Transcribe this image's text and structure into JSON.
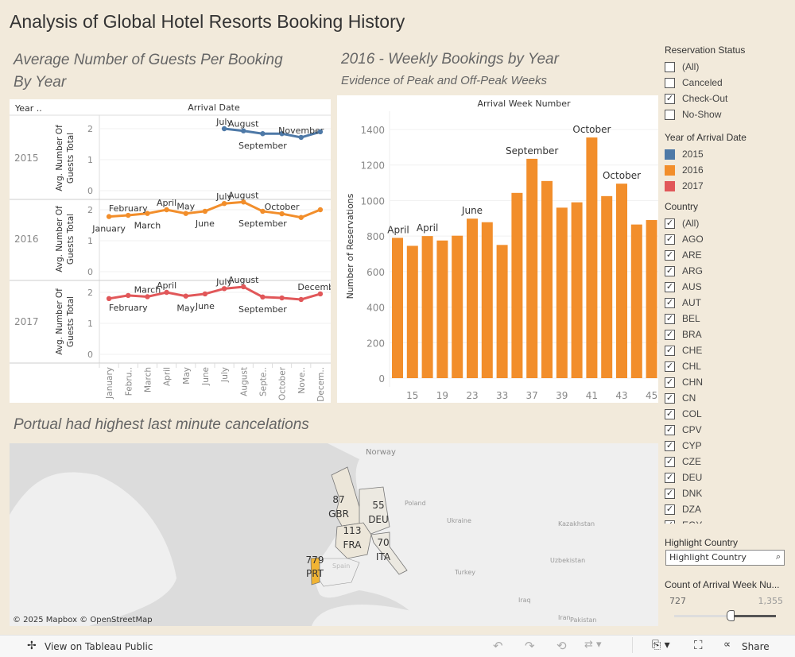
{
  "title": "Analysis of Global Hotel Resorts Booking History",
  "guests_chart": {
    "title_line1": "Average Number of Guests Per Booking",
    "title_line2": "By Year",
    "row_header": "Year ..",
    "col_header": "Arrival Date",
    "y_axis_label_line1": "Avg. Number Of",
    "y_axis_label_line2": "Guests Total",
    "y_ticks": [
      "0",
      "1",
      "2"
    ],
    "months_axis": [
      "January",
      "Febru..",
      "March",
      "April",
      "May",
      "June",
      "July",
      "August",
      "Septe..",
      "October",
      "Nove..",
      "Decem.."
    ]
  },
  "chart_data": [
    {
      "type": "line",
      "title": "Average Number of Guests Per Booking By Year",
      "xlabel": "Arrival Date",
      "ylabel": "Avg. Number Of Guests Total",
      "ylim": [
        0,
        2.3
      ],
      "categories": [
        "January",
        "February",
        "March",
        "April",
        "May",
        "June",
        "July",
        "August",
        "September",
        "October",
        "November",
        "December"
      ],
      "series": [
        {
          "name": "2015",
          "color": "#4e79a7",
          "values": [
            null,
            null,
            null,
            null,
            null,
            null,
            2.0,
            1.93,
            1.84,
            1.84,
            1.72,
            1.9
          ],
          "labels_above": [
            "July",
            "August",
            "November"
          ],
          "labels_below": [
            "September"
          ]
        },
        {
          "name": "2016",
          "color": "#f28e2b",
          "values": [
            1.78,
            1.82,
            1.88,
            2.0,
            1.88,
            1.95,
            2.2,
            2.25,
            1.95,
            1.87,
            1.75,
            2.0
          ],
          "labels_above": [
            "February",
            "April",
            "May",
            "July",
            "August",
            "October"
          ],
          "labels_below": [
            "January",
            "March",
            "June",
            "September"
          ]
        },
        {
          "name": "2017",
          "color": "#e15759",
          "values": [
            1.8,
            1.9,
            1.86,
            2.0,
            1.88,
            1.95,
            2.12,
            2.18,
            1.85,
            1.82,
            1.77,
            1.95
          ],
          "labels_above": [
            "March",
            "April",
            "July",
            "August",
            "December"
          ],
          "labels_below": [
            "February",
            "May",
            "June",
            "September"
          ]
        }
      ]
    },
    {
      "type": "bar",
      "title": "2016 - Weekly Bookings by Year",
      "subtitle": "Evidence of Peak and Off-Peak Weeks",
      "xlabel": "Arrival Week Number",
      "ylabel": "Number of Reservations",
      "ylim": [
        0,
        1450
      ],
      "y_ticks": [
        0,
        200,
        400,
        600,
        800,
        1000,
        1200,
        1400
      ],
      "categories": [
        "",
        "15",
        "",
        "19",
        "",
        "23",
        "",
        "33",
        "",
        "37",
        "",
        "39",
        "",
        "41",
        "",
        "43",
        "",
        "45"
      ],
      "values": [
        790,
        745,
        800,
        775,
        802,
        898,
        878,
        750,
        1043,
        1235,
        1110,
        960,
        990,
        1355,
        1025,
        1095,
        865,
        890
      ],
      "bar_labels": [
        "April",
        "",
        "April",
        "",
        "",
        "June",
        "",
        "",
        "",
        "September",
        "",
        "",
        "",
        "October",
        "",
        "October",
        "",
        ""
      ],
      "color": "#f28e2b"
    }
  ],
  "map": {
    "title": "Portual had highest last minute cancelations",
    "attribution": "© 2025 Mapbox  © OpenStreetMap",
    "countries": [
      {
        "code": "GBR",
        "value": "87"
      },
      {
        "code": "DEU",
        "value": "55"
      },
      {
        "code": "FRA",
        "value": "113"
      },
      {
        "code": "ITA",
        "value": "70"
      },
      {
        "code": "PRT",
        "value": "779"
      }
    ],
    "place_names": [
      "Norway",
      "Poland",
      "Ukraine",
      "Kazakhstan",
      "Turkey",
      "Spain",
      "Iraq",
      "Iran",
      "Pakistan",
      "Uzbekistan"
    ]
  },
  "filters": {
    "reservation_status": {
      "title": "Reservation Status",
      "items": [
        {
          "label": "(All)",
          "checked": false
        },
        {
          "label": "Canceled",
          "checked": false
        },
        {
          "label": "Check-Out",
          "checked": true
        },
        {
          "label": "No-Show",
          "checked": false
        }
      ]
    },
    "year_legend": {
      "title": "Year of Arrival Date",
      "items": [
        {
          "label": "2015",
          "color": "#4e79a7"
        },
        {
          "label": "2016",
          "color": "#f28e2b"
        },
        {
          "label": "2017",
          "color": "#e15759"
        }
      ]
    },
    "country": {
      "title": "Country",
      "items": [
        "(All)",
        "AGO",
        "ARE",
        "ARG",
        "AUS",
        "AUT",
        "BEL",
        "BRA",
        "CHE",
        "CHL",
        "CHN",
        "CN",
        "COL",
        "CPV",
        "CYP",
        "CZE",
        "DEU",
        "DNK",
        "DZA",
        "EGY"
      ]
    },
    "highlight": {
      "title": "Highlight Country",
      "placeholder": "Highlight Country"
    },
    "slider": {
      "title": "Count of Arrival Week Nu...",
      "min_label": "727",
      "max_label": "1,355",
      "min": 727,
      "max": 1355,
      "value": 1100
    }
  },
  "toolbar": {
    "view_label": "View on Tableau Public",
    "share_label": "Share"
  }
}
